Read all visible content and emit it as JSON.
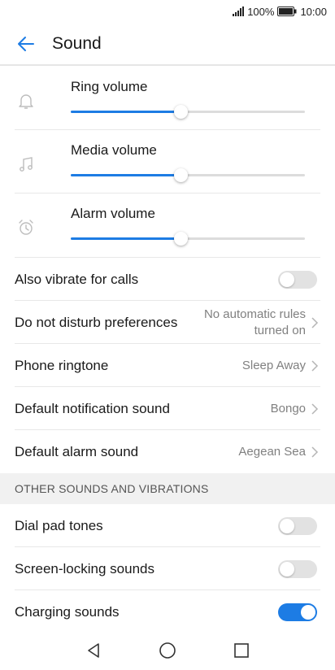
{
  "status_bar": {
    "battery": "100%",
    "time": "10:00"
  },
  "header": {
    "title": "Sound"
  },
  "volumes": [
    {
      "label": "Ring volume",
      "icon": "bell-icon",
      "level": 0.47
    },
    {
      "label": "Media volume",
      "icon": "music-note-icon",
      "level": 0.47
    },
    {
      "label": "Alarm volume",
      "icon": "alarm-clock-icon",
      "level": 0.47
    }
  ],
  "settings": {
    "also_vibrate": {
      "label": "Also vibrate for calls",
      "enabled": false
    },
    "dnd": {
      "label": "Do not disturb preferences",
      "value_line1": "No automatic rules",
      "value_line2": "turned on"
    },
    "ringtone": {
      "label": "Phone ringtone",
      "value": "Sleep Away"
    },
    "notification": {
      "label": "Default notification sound",
      "value": "Bongo"
    },
    "alarm": {
      "label": "Default alarm sound",
      "value": "Aegean Sea"
    }
  },
  "other_section": {
    "title": "OTHER SOUNDS AND VIBRATIONS",
    "items": [
      {
        "label": "Dial pad tones",
        "enabled": false
      },
      {
        "label": "Screen-locking sounds",
        "enabled": false
      },
      {
        "label": "Charging sounds",
        "enabled": true
      }
    ]
  },
  "colors": {
    "accent": "#1d7ce4",
    "toggle_off": "#e2e2e2",
    "section_bg": "#f1f1f1"
  }
}
